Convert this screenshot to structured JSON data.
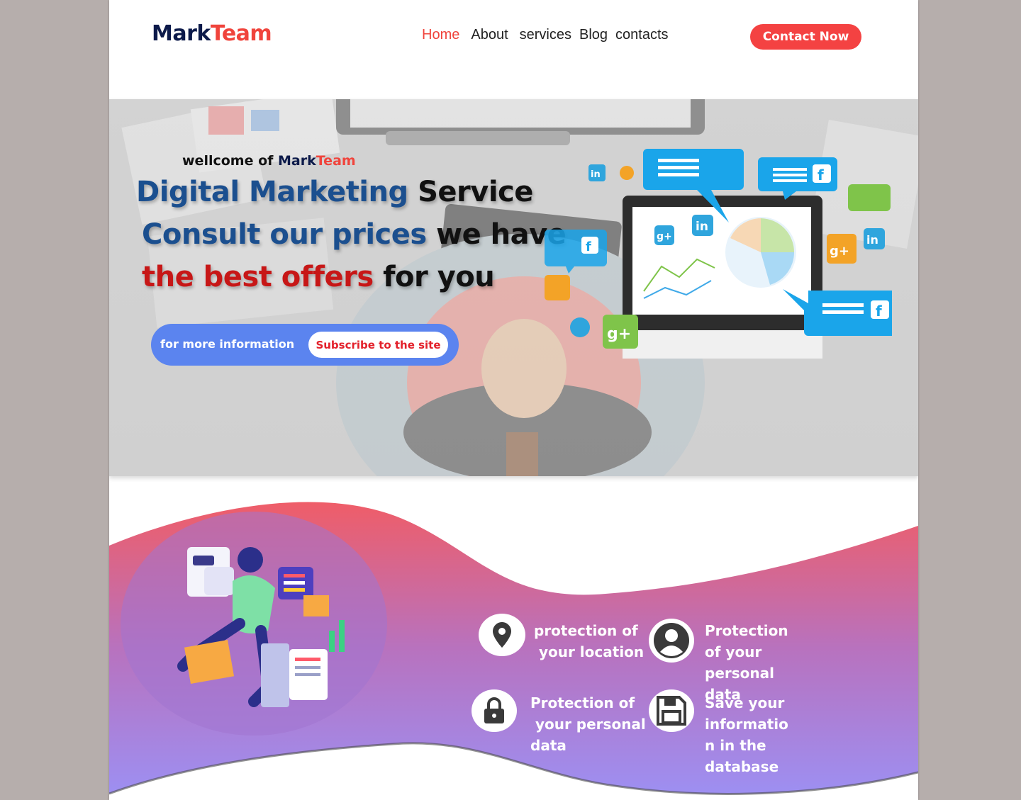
{
  "header": {
    "logo_part1": "Mark",
    "logo_part2": "Team",
    "nav": [
      {
        "label": "Home",
        "active": true
      },
      {
        "label": "About"
      },
      {
        "label": "services"
      },
      {
        "label": "Blog"
      },
      {
        "label": "contacts"
      }
    ],
    "contact_button": "Contact Now"
  },
  "hero": {
    "welcome_prefix": "wellcome of ",
    "welcome_brand1": "Mark",
    "welcome_brand2": "Team",
    "line1_blue": "Digital Marketing",
    "line1_dark": "Service",
    "line2_blue": "Consult our prices",
    "line2_dark": "we have",
    "line3_red": "the best offers",
    "line3_dark": "for you",
    "cta_label": "for more information",
    "subscribe_button": "Subscribe to the site"
  },
  "features": [
    {
      "icon": "location-pin-icon",
      "line1": "protection of",
      "line2": " your location"
    },
    {
      "icon": "user-avatar-icon",
      "line1": "Protection of your",
      "line2": "personal data"
    },
    {
      "icon": "lock-icon",
      "line1": "Protection of",
      "line2": " your personal",
      "line3": "data"
    },
    {
      "icon": "floppy-disk-icon",
      "line1": "Save your informatio",
      "line2": "n in the database"
    }
  ],
  "colors": {
    "brand_dark": "#0c1a4a",
    "brand_red": "#f0443c",
    "accent_blue": "#5b84ef",
    "wave_top": "#ef5d68",
    "wave_bottom": "#9d8ff2"
  }
}
